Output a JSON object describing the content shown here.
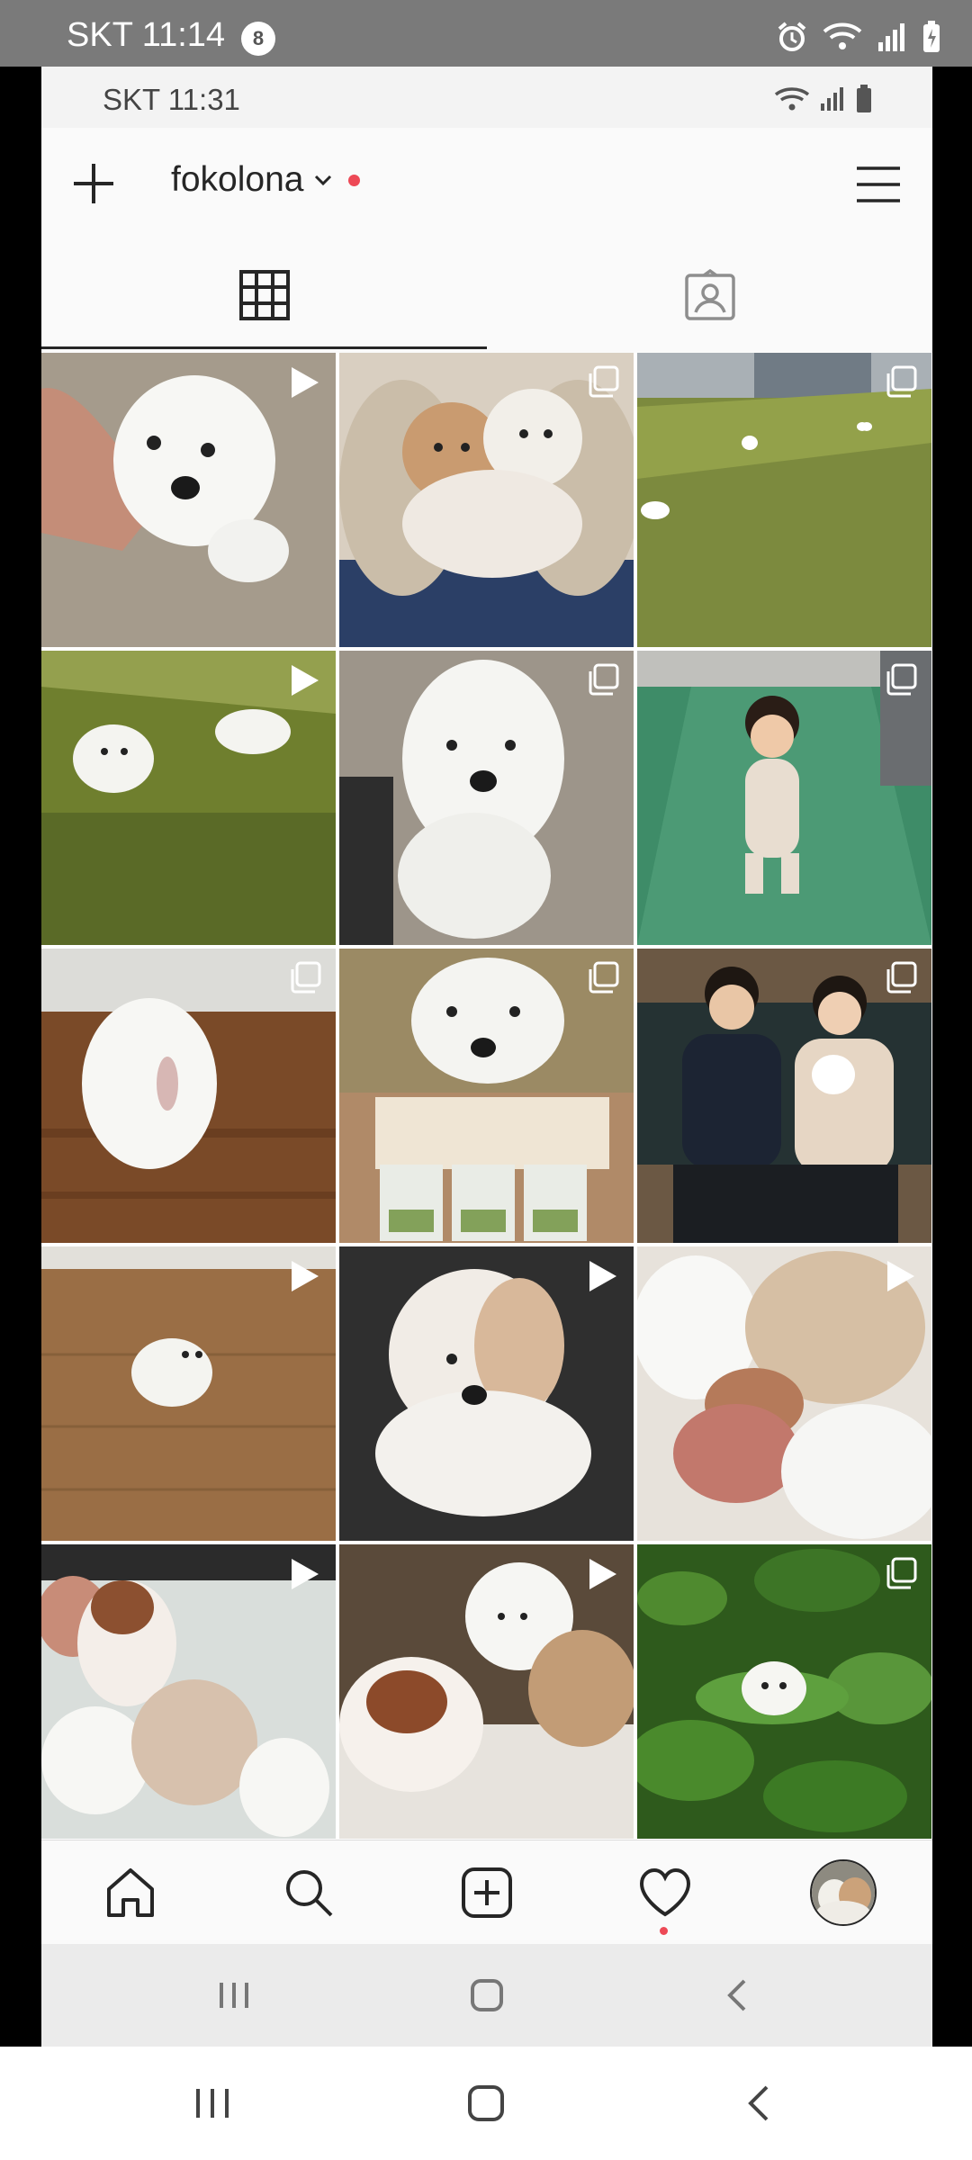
{
  "device": {
    "carrier": "SKT",
    "time": "11:14",
    "notification_count": "8"
  },
  "inner_device": {
    "carrier": "SKT",
    "time": "11:31"
  },
  "header": {
    "username": "fokolona"
  },
  "icons": {
    "new_post": "plus-icon",
    "account_switch": "chevron-down-icon",
    "menu": "hamburger-menu-icon",
    "grid_tab": "grid-icon",
    "tagged_tab": "tagged-person-icon",
    "video_badge": "play-icon",
    "album_badge": "carousel-icon",
    "home": "home-icon",
    "search": "search-icon",
    "create": "add-post-icon",
    "activity": "heart-icon"
  },
  "colors": {
    "notification_dot": "#ed4956",
    "text": "#262626"
  },
  "posts": [
    {
      "badge": "video"
    },
    {
      "badge": "album"
    },
    {
      "badge": "album"
    },
    {
      "badge": "video"
    },
    {
      "badge": "album"
    },
    {
      "badge": "album"
    },
    {
      "badge": "album"
    },
    {
      "badge": "album"
    },
    {
      "badge": "album"
    },
    {
      "badge": "video"
    },
    {
      "badge": "video"
    },
    {
      "badge": "video"
    },
    {
      "badge": "video"
    },
    {
      "badge": "video"
    },
    {
      "badge": "album"
    }
  ]
}
